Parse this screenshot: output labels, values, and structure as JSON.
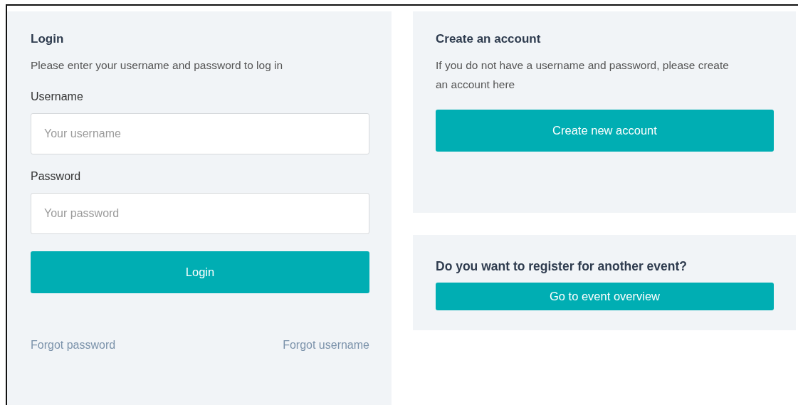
{
  "login": {
    "title": "Login",
    "description": "Please enter your username and password to log in",
    "fields": [
      {
        "label": "Username",
        "placeholder": "Your username"
      },
      {
        "label": "Password",
        "placeholder": "Your password"
      }
    ],
    "button": "Login",
    "links": [
      "Forgot password",
      "Forgot username"
    ]
  },
  "create_account": {
    "title": "Create an account",
    "description": "If you do not have a username and password, please create an account here",
    "button": "Create new account"
  },
  "other_event": {
    "title": "Do you want to register for another event?",
    "button": "Go to event overview"
  }
}
